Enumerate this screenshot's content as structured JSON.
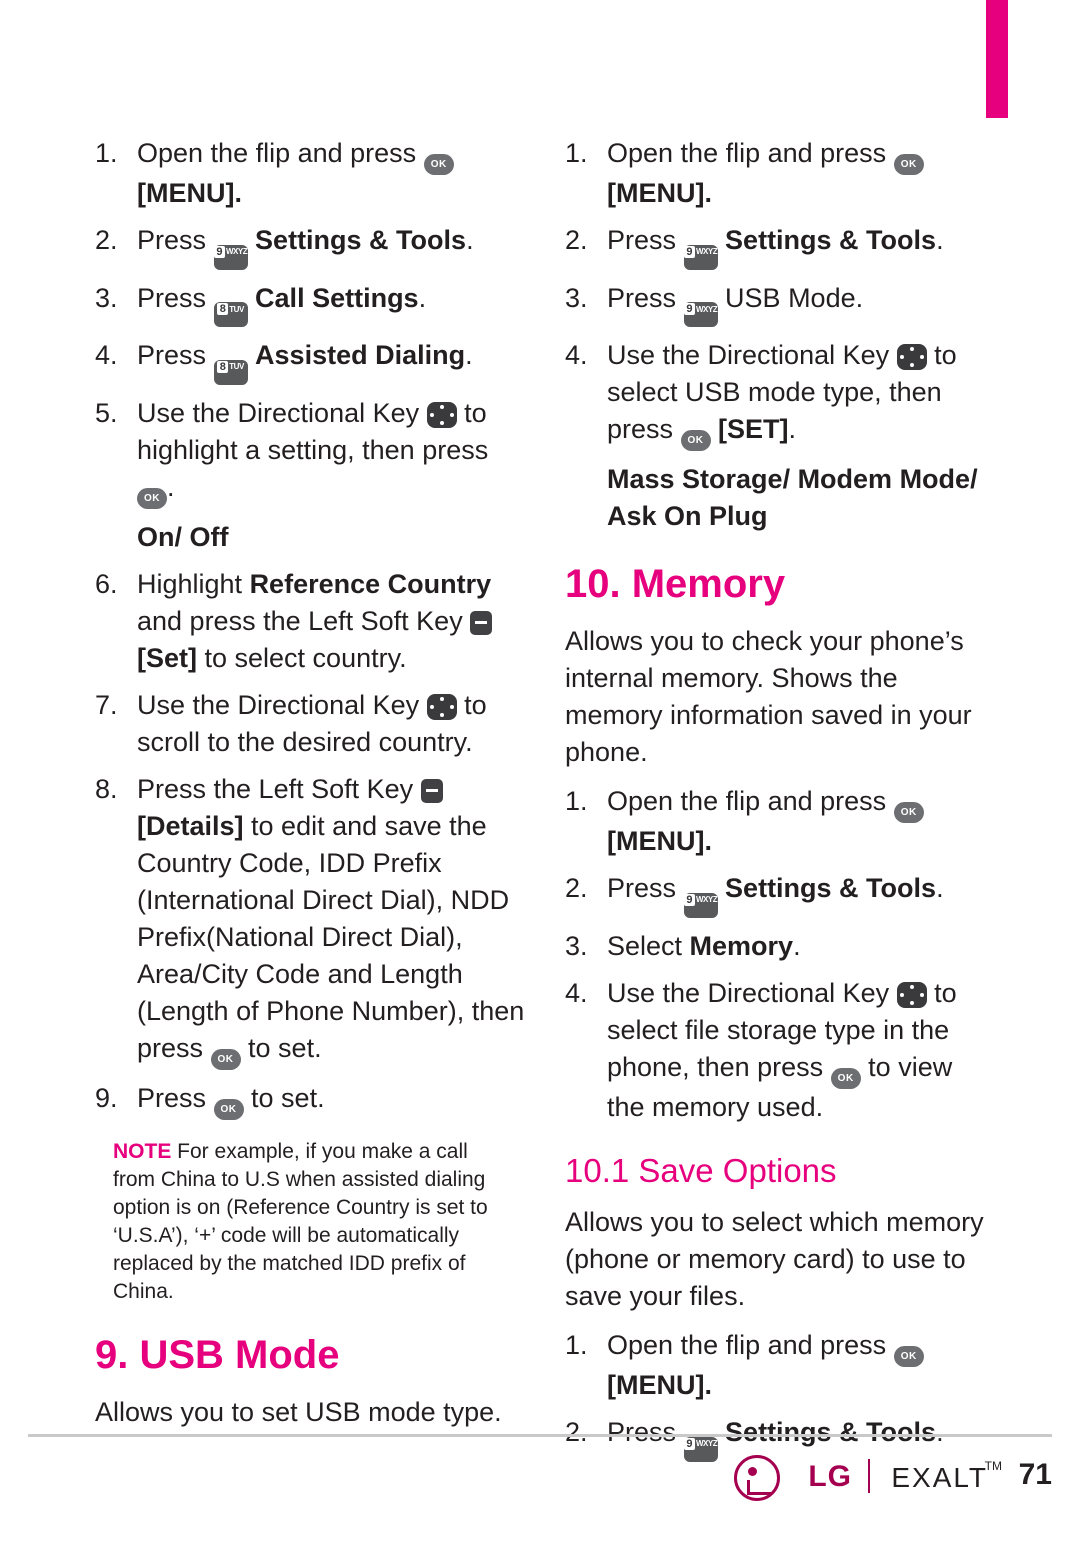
{
  "page": {
    "number": "71",
    "brand": "LG",
    "model": "EXALT",
    "tm": "TM"
  },
  "left_column": {
    "steps": [
      {
        "num": "1.",
        "pre": "Open the flip and press ",
        "icon": "ok-key",
        "post": "",
        "bold_line": "[MENU]."
      },
      {
        "num": "2.",
        "pre": "Press ",
        "icon": "key-9-wxyz",
        "post": "",
        "bold": "Settings & Tools",
        "tail": "."
      },
      {
        "num": "3.",
        "pre": "Press ",
        "icon": "key-8-tuv",
        "post": "",
        "bold": "Call Settings",
        "tail": "."
      },
      {
        "num": "4.",
        "pre": "Press ",
        "icon": "key-8-tuv",
        "post": "",
        "bold": "Assisted Dialing",
        "tail": "."
      },
      {
        "num": "5.",
        "pre": "Use the Directional Key ",
        "icon": "directional-key",
        "post": " to highlight a setting, then press ",
        "icon2": "ok-key",
        "tail": "."
      }
    ],
    "on_off_label": "On/ Off",
    "steps2": [
      {
        "num": "6.",
        "pre": "Highlight ",
        "bold": "Reference Country",
        "mid": " and press the Left Soft Key ",
        "icon": "left-soft-key",
        "bold2": "[Set]",
        "tail": " to select country."
      },
      {
        "num": "7.",
        "pre": "Use the Directional Key ",
        "icon": "directional-key",
        "tail": " to scroll to the desired country."
      },
      {
        "num": "8.",
        "pre": "Press the Left Soft Key ",
        "icon": "left-soft-key",
        "bold2": "[Details]",
        "tail": " to edit and save the Country Code, IDD Prefix (International Direct Dial), NDD Prefix(National Direct Dial), Area/City Code and Length (Length of Phone Number), then press ",
        "icon2": "ok-key",
        "tail2": " to set."
      },
      {
        "num": "9.",
        "pre": "Press ",
        "icon": "ok-key",
        "tail": " to set."
      }
    ],
    "note": {
      "tag": "NOTE",
      "text": " For example, if you make a call from China to U.S when assisted dialing option is on (Reference Country is set to ‘U.S.A’), ‘+’ code will be automatically replaced by the matched IDD prefix of China."
    },
    "usb_heading": "9. USB Mode",
    "usb_intro": "Allows you to set USB mode type."
  },
  "right_column": {
    "steps_usb": [
      {
        "num": "1.",
        "pre": "Open the flip and press ",
        "icon": "ok-key",
        "bold_line": "[MENU]."
      },
      {
        "num": "2.",
        "pre": "Press ",
        "icon": "key-9-wxyz",
        "bold": "Settings & Tools",
        "tail": "."
      },
      {
        "num": "3.",
        "pre": "Press ",
        "icon": "key-9-wxyz",
        "bold": "USB Mode",
        "tail": "."
      },
      {
        "num": "4.",
        "pre": "Use the Directional Key ",
        "icon": "directional-key",
        "tail": " to select USB mode type, then press ",
        "icon2": "ok-key",
        "bold2": "[SET]",
        "tail2": "."
      }
    ],
    "usb_modes": "Mass Storage/ Modem Mode/ Ask On Plug",
    "memory_heading": "10. Memory",
    "memory_intro": "Allows you to check your phone’s internal memory. Shows the memory information saved in your phone.",
    "steps_memory": [
      {
        "num": "1.",
        "pre": "Open the flip and press ",
        "icon": "ok-key",
        "bold_line": "[MENU]."
      },
      {
        "num": "2.",
        "pre": "Press ",
        "icon": "key-9-wxyz",
        "bold": "Settings & Tools",
        "tail": "."
      },
      {
        "num": "3.",
        "pre": "Select ",
        "bold": "Memory",
        "tail": "."
      },
      {
        "num": "4.",
        "pre": "Use the Directional Key ",
        "icon": "directional-key",
        "tail": " to select file storage type in the phone, then press ",
        "icon2": "ok-key",
        "tail2": " to view the memory used."
      }
    ],
    "save_options_heading_num": "10.1 ",
    "save_options_heading": "Save Options",
    "save_options_intro": "Allows you to select which memory (phone or memory card) to use to save your files.",
    "steps_save": [
      {
        "num": "1.",
        "pre": "Open the flip and press ",
        "icon": "ok-key",
        "bold_line": "[MENU]."
      },
      {
        "num": "2.",
        "pre": "Press ",
        "icon": "key-9-wxyz",
        "bold": "Settings & Tools",
        "tail": "."
      }
    ]
  },
  "keys": {
    "ok_label": "OK",
    "k9_digit": "9",
    "k9_letters": "WXYZ",
    "k8_digit": "8",
    "k8_letters": "TUV"
  },
  "colors": {
    "accent": "#e6007e",
    "text": "#231f20",
    "logo": "#a50050"
  }
}
